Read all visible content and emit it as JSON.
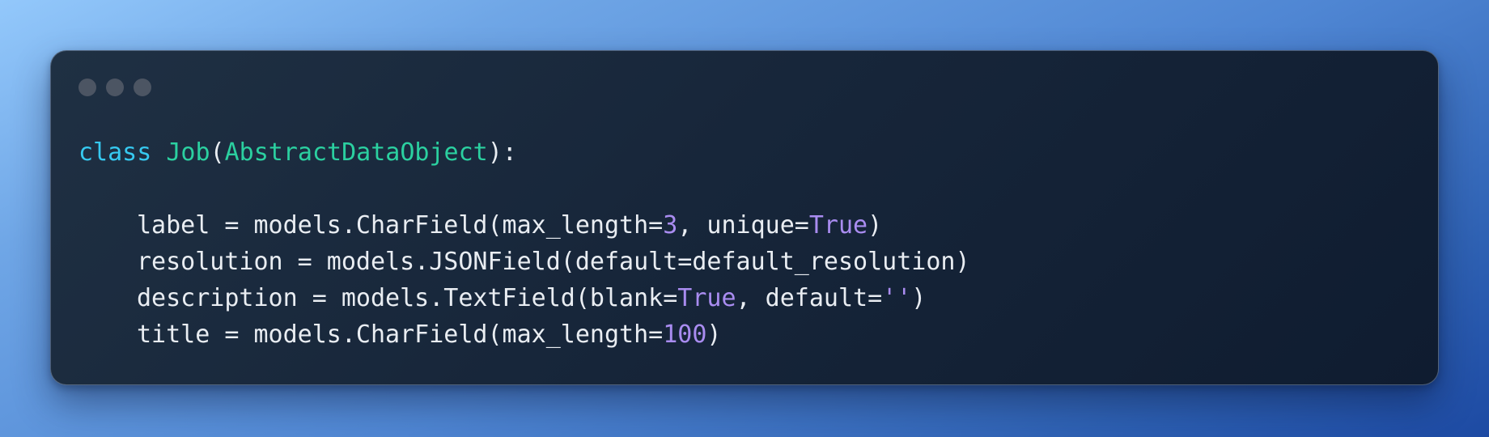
{
  "colors": {
    "keyword": "#36c9f0",
    "class_name": "#2bd0a0",
    "literal": "#a98cf0",
    "text": "#e9edf2",
    "window_dot": "#4c5563"
  },
  "window": {
    "controls": [
      "close-dot",
      "minimize-dot",
      "maximize-dot"
    ]
  },
  "code": {
    "line1": {
      "keyword": "class",
      "class_name": "Job",
      "open_paren": "(",
      "base_class": "AbstractDataObject",
      "close": "):"
    },
    "line3": {
      "pre": "label = models.CharField(max_length=",
      "num": "3",
      "mid": ", unique=",
      "const": "True",
      "post": ")"
    },
    "line4": {
      "text": "resolution = models.JSONField(default=default_resolution)"
    },
    "line5": {
      "pre": "description = models.TextField(blank=",
      "const": "True",
      "mid": ", default=",
      "str": "''",
      "post": ")"
    },
    "line6": {
      "pre": "title = models.CharField(max_length=",
      "num": "100",
      "post": ")"
    }
  }
}
